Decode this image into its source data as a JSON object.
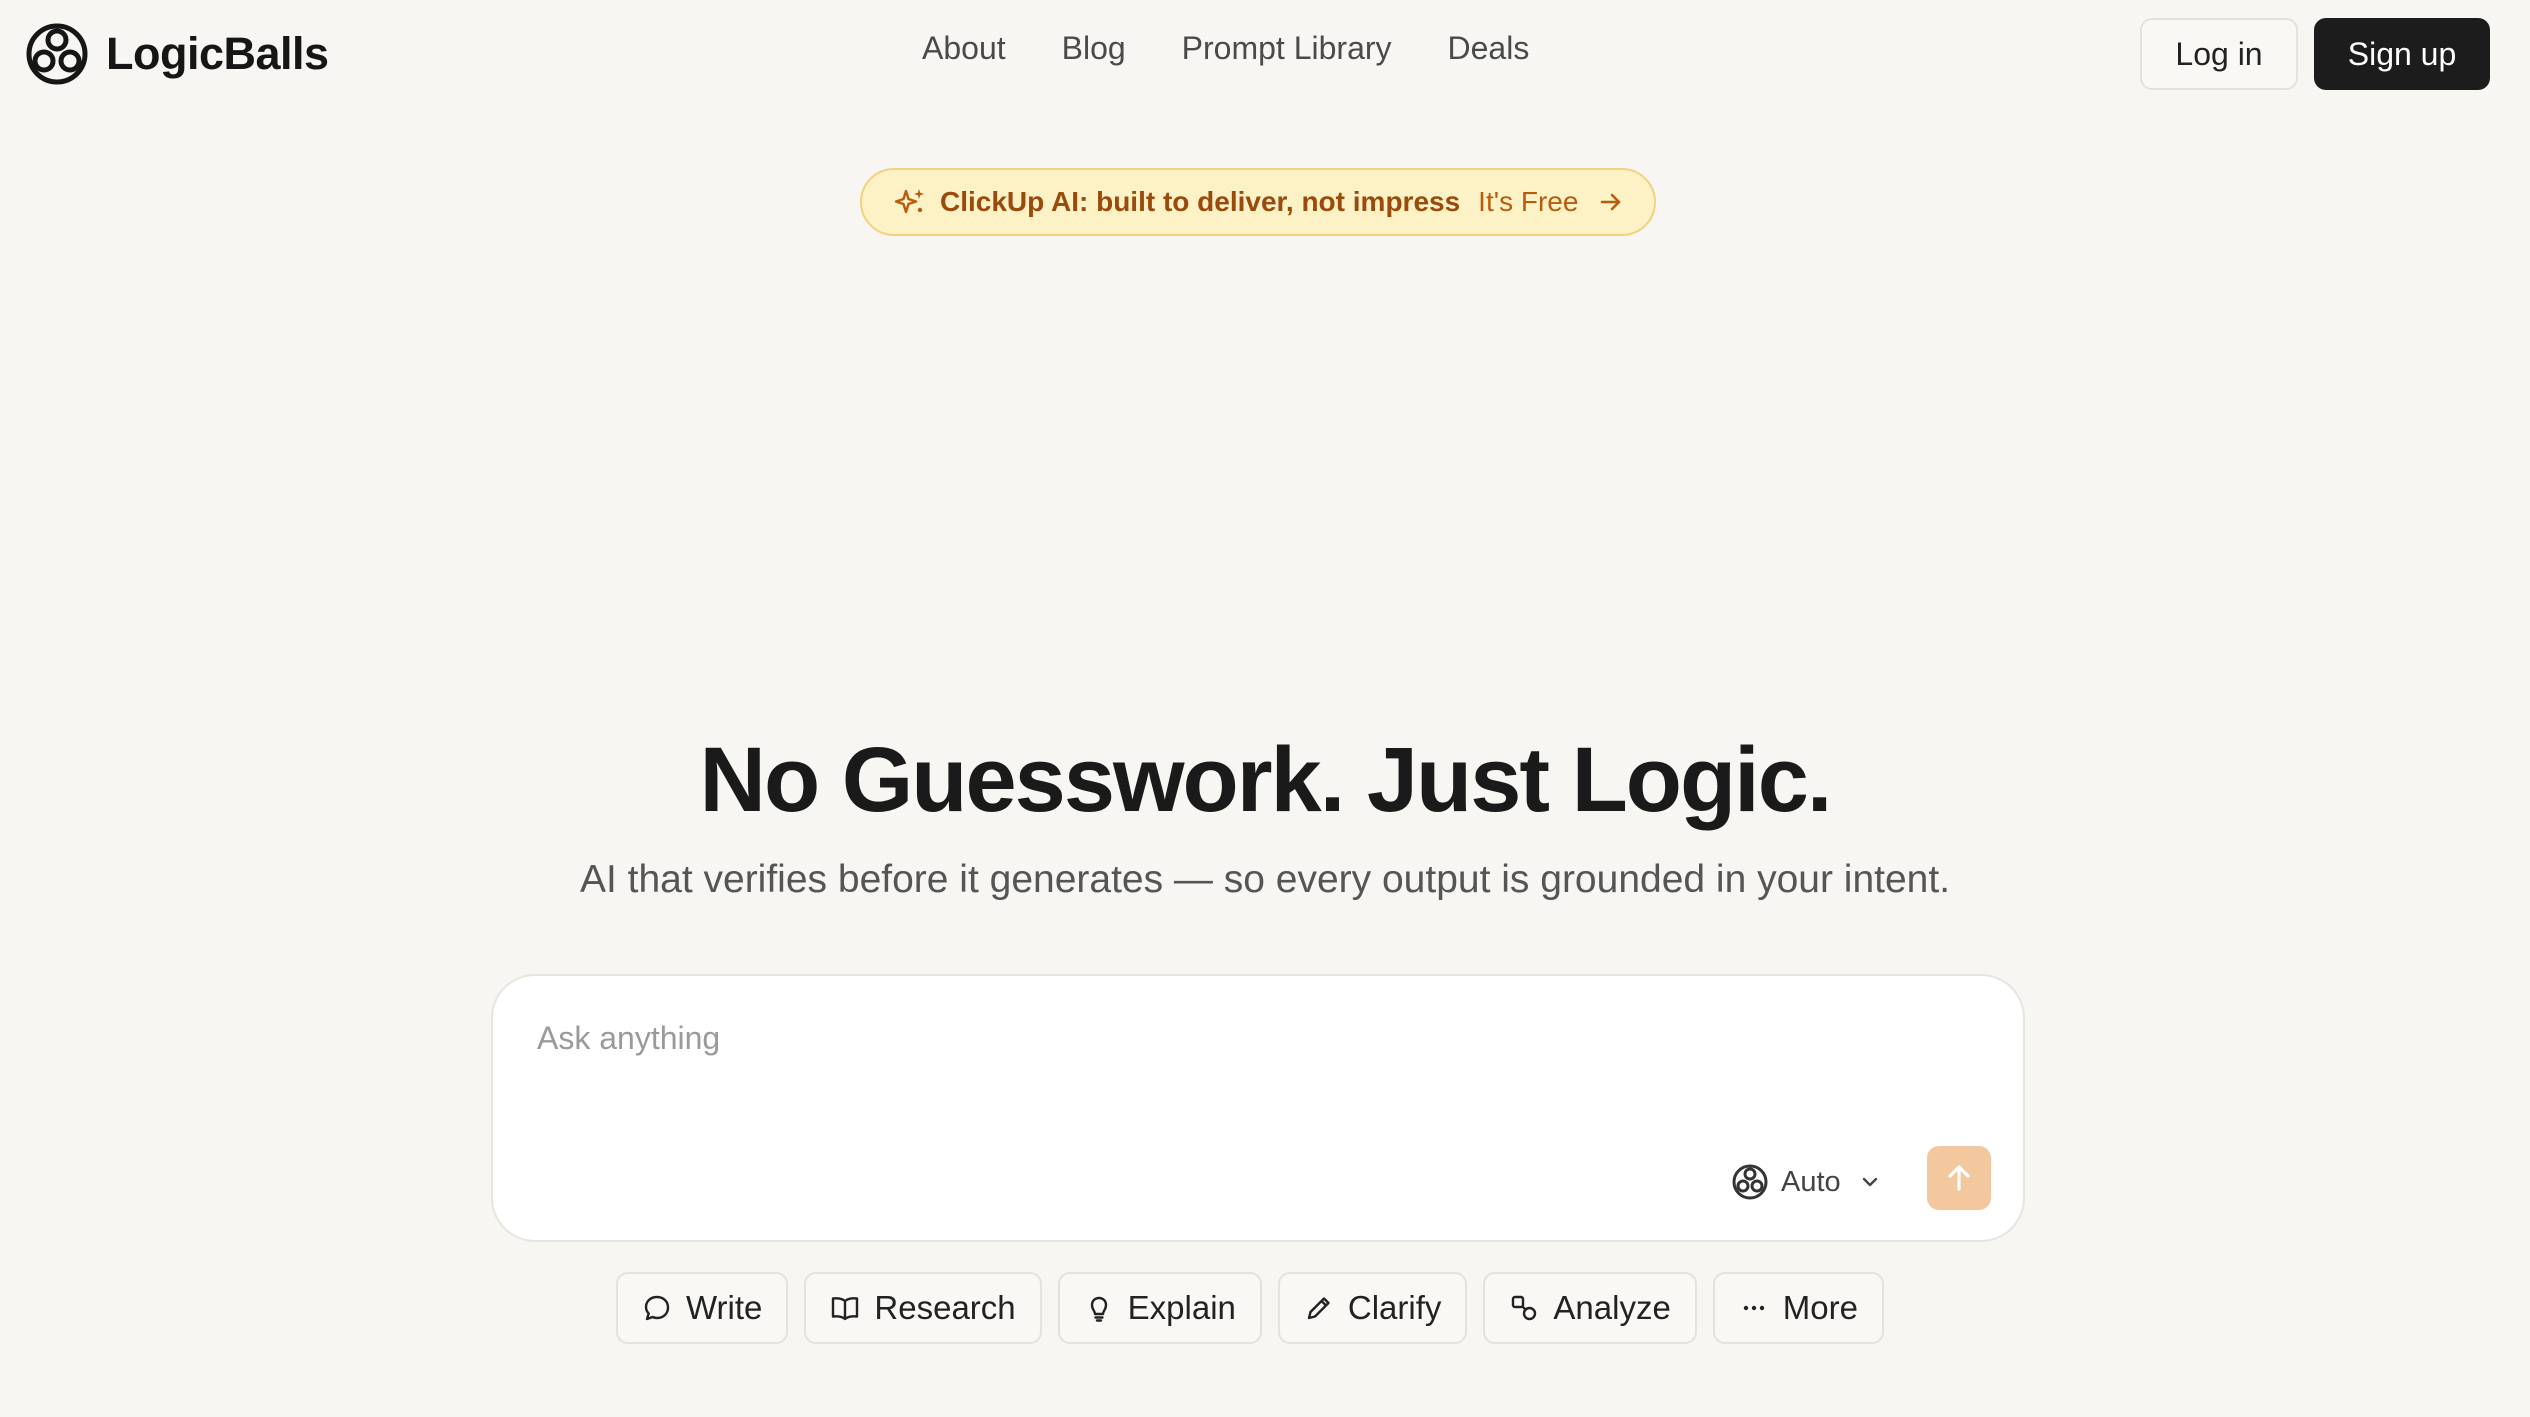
{
  "brand": {
    "name": "LogicBalls"
  },
  "nav": {
    "items": [
      {
        "label": "About"
      },
      {
        "label": "Blog"
      },
      {
        "label": "Prompt Library"
      },
      {
        "label": "Deals"
      }
    ]
  },
  "auth": {
    "login_label": "Log in",
    "signup_label": "Sign up"
  },
  "promo": {
    "text": "ClickUp AI: built to deliver, not impress",
    "cta": "It's Free"
  },
  "hero": {
    "title": "No Guesswork. Just Logic.",
    "subtitle": "AI that verifies before it generates — so every output is grounded in your intent."
  },
  "prompt": {
    "placeholder": "Ask anything",
    "value": "",
    "model_label": "Auto"
  },
  "actions": [
    {
      "label": "Write",
      "icon": "chat-bubble-icon"
    },
    {
      "label": "Research",
      "icon": "book-icon"
    },
    {
      "label": "Explain",
      "icon": "lightbulb-icon"
    },
    {
      "label": "Clarify",
      "icon": "pencil-icon"
    },
    {
      "label": "Analyze",
      "icon": "shapes-icon"
    },
    {
      "label": "More",
      "icon": "ellipsis-icon"
    }
  ],
  "colors": {
    "background": "#f7f6f2",
    "primary_button": "#1c1c1c",
    "promo_bg": "#fdf1c6",
    "promo_border": "#f3d27d",
    "promo_text": "#9a4a0b",
    "send_button": "#f4c89e"
  }
}
